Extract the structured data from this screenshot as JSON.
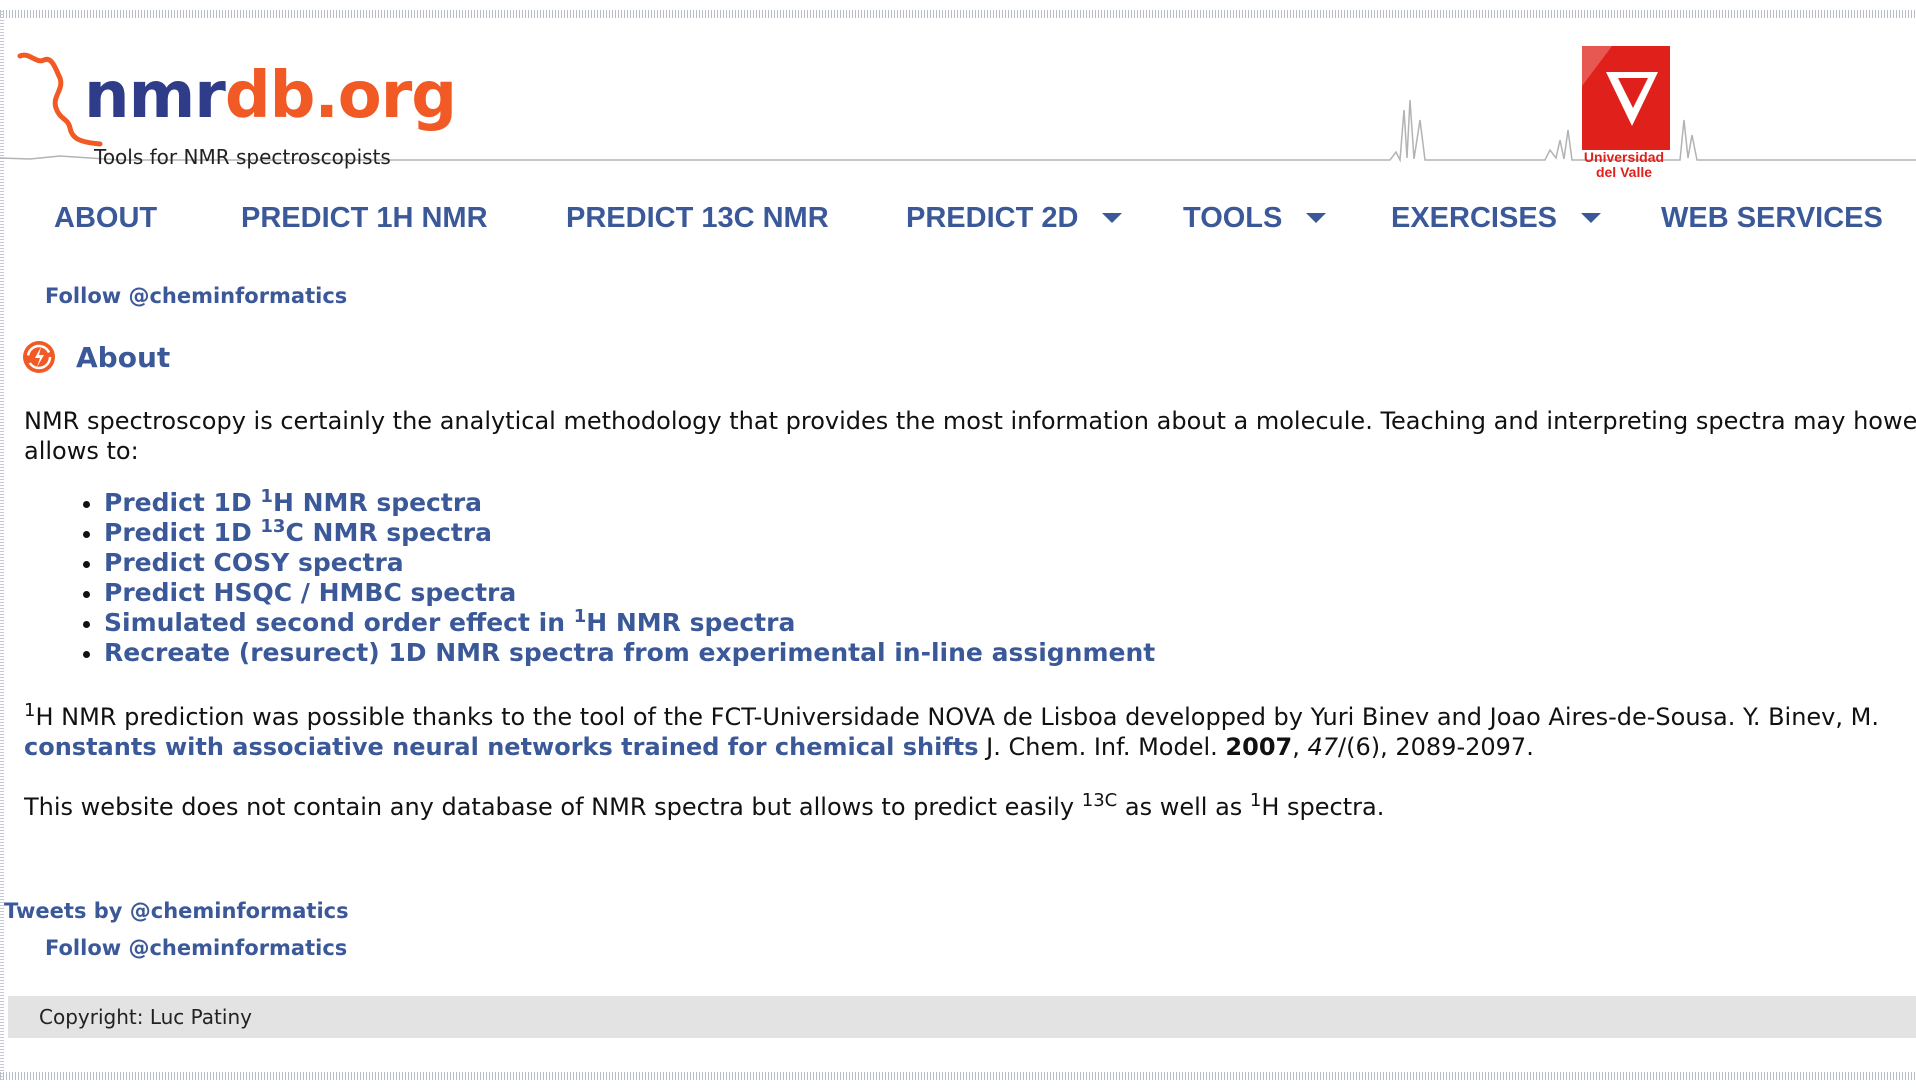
{
  "header": {
    "logo": {
      "part1": "nmr",
      "part2": "db.org",
      "tagline": "Tools for NMR spectroscopists"
    },
    "partner_logo": {
      "line1": "Universidad",
      "line2": "del Valle"
    }
  },
  "nav": {
    "items": [
      {
        "label": "ABOUT",
        "dropdown": false
      },
      {
        "label": "PREDICT 1H NMR",
        "dropdown": false
      },
      {
        "label": "PREDICT 13C NMR",
        "dropdown": false
      },
      {
        "label": "PREDICT 2D",
        "dropdown": true
      },
      {
        "label": "TOOLS",
        "dropdown": true
      },
      {
        "label": "EXERCISES",
        "dropdown": true
      },
      {
        "label": "WEB SERVICES",
        "dropdown": false
      }
    ]
  },
  "follow": {
    "top": "Follow @cheminformatics",
    "bottom": "Follow @cheminformatics"
  },
  "tweets_link": "Tweets by @cheminformatics",
  "section": {
    "title": "About",
    "icon": "about-badge-icon"
  },
  "intro": {
    "line1": "NMR spectroscopy is certainly the analytical methodology that provides the most information about a molecule. Teaching and interpreting spectra may howe",
    "line2": "allows to:"
  },
  "features": {
    "f1": {
      "pre": "Predict 1D ",
      "sup": "1",
      "post": "H NMR spectra"
    },
    "f2": {
      "pre": "Predict 1D ",
      "sup": "13",
      "post": "C NMR spectra"
    },
    "f3": {
      "text": "Predict COSY spectra"
    },
    "f4": {
      "text": "Predict HSQC / HMBC spectra"
    },
    "f5": {
      "pre": "Simulated second order effect in ",
      "sup": "1",
      "post": "H NMR spectra"
    },
    "f6": {
      "text": "Recreate (resurect) 1D NMR spectra from experimental in-line assignment"
    }
  },
  "credit": {
    "sup": "1",
    "line1": "H NMR prediction was possible thanks to the tool of the FCT-Universidade NOVA de Lisboa developped by Yuri Binev and Joao Aires-de-Sousa. Y. Binev, M.",
    "link": "constants with associative neural networks trained for chemical shifts",
    "journal": " J. Chem. Inf. Model. ",
    "year": "2007",
    "sep": ", ",
    "volume": "47",
    "rest": "/(6), 2089-2097."
  },
  "database_note": {
    "pre": "This website does not contain any database of NMR spectra but allows to predict easily ",
    "sup1": "13C",
    "mid": " as well as ",
    "sup2": "1",
    "post": "H spectra."
  },
  "footer": {
    "copyright": "Copyright: Luc Patiny"
  },
  "colors": {
    "link": "#3b5998",
    "brand_orange": "#f15a24",
    "brand_navy": "#2e3c8a",
    "univalle_red": "#e0201a",
    "footer_bg": "#e3e3e3"
  }
}
